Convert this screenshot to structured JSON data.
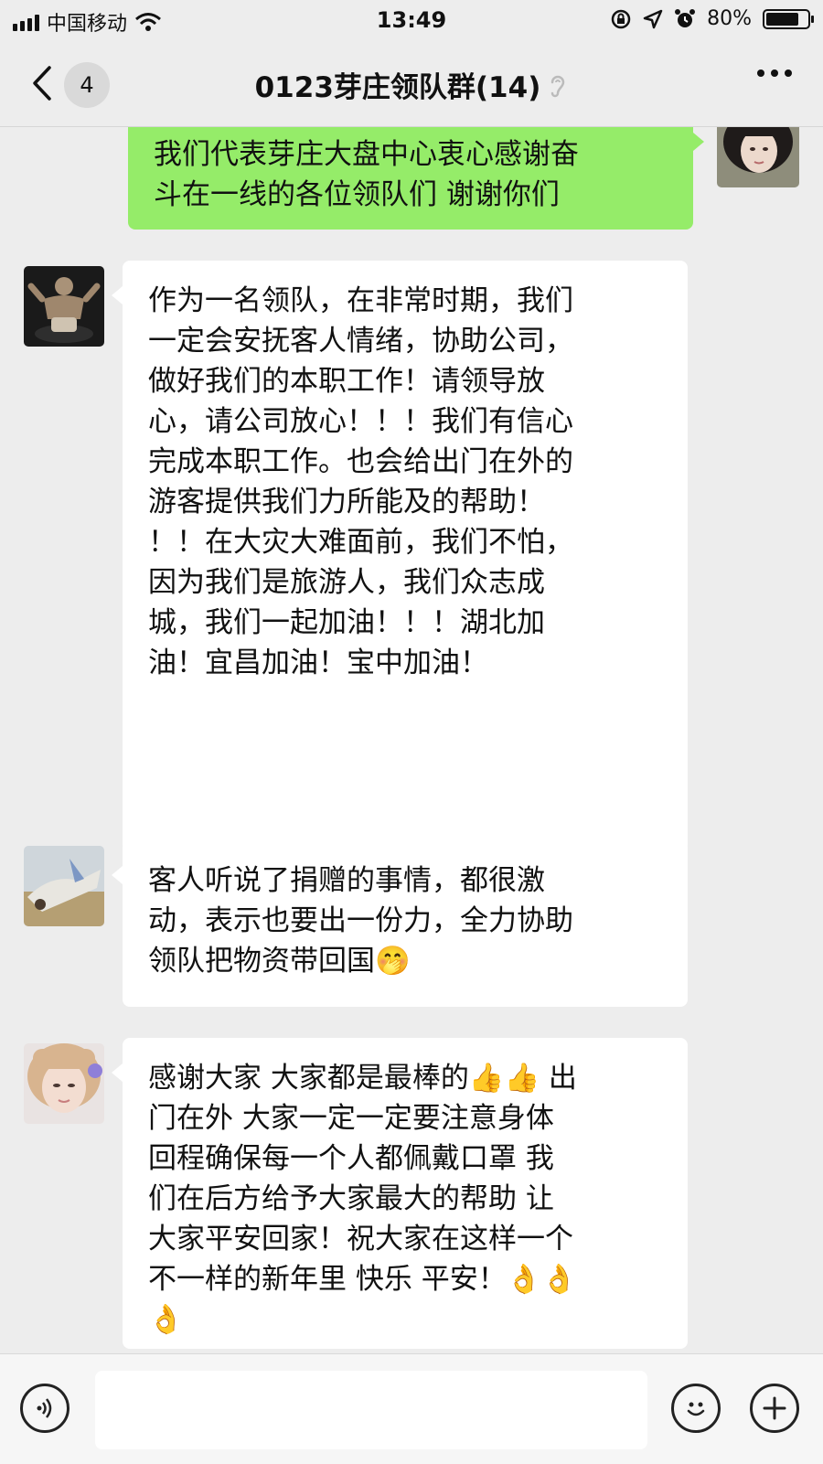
{
  "status_bar": {
    "carrier": "中国移动",
    "time": "13:49",
    "battery": "80%",
    "battery_level": 0.8
  },
  "header": {
    "back_count": "4",
    "title": "0123芽庄领队群(14)",
    "icons": [
      "back-chevron-icon",
      "earpiece-icon",
      "more-icon"
    ]
  },
  "messages": [
    {
      "side": "out",
      "avatar": "avatar-woman-dark-hair",
      "text": "我们代表芽庄大盘中心衷心感谢奋\n斗在一线的各位领队们 谢谢你们"
    },
    {
      "side": "in",
      "avatar": "avatar-figure-dark",
      "text": "作为一名领队，在非常时期，我们\n一定会安抚客人情绪，协助公司，\n做好我们的本职工作！请领导放\n心，请公司放心！！！我们有信心\n完成本职工作。也会给出门在外的\n游客提供我们力所能及的帮助！\n！！在大灾大难面前，我们不怕，\n因为我们是旅游人，我们众志成\n城，我们一起加油！！！湖北加\n油！宜昌加油！宝中加油！"
    },
    {
      "side": "in",
      "avatar": "avatar-landscape",
      "text": "客人听说了捐赠的事情，都很激\n动，表示也要出一份力，全力协助\n领队把物资带回国🤭"
    },
    {
      "side": "in",
      "avatar": "avatar-girl-light-hair",
      "text": "感谢大家 大家都是最棒的👍👍 出\n门在外 大家一定一定要注意身体\n回程确保每一个人都佩戴口罩 我\n们在后方给予大家最大的帮助 让\n大家平安回家！祝大家在这样一个\n不一样的新年里 快乐 平安！👌👌\n👌"
    }
  ],
  "timestamp": "13:49",
  "input_bar": {
    "icons": [
      "voice-icon",
      "emoji-icon",
      "plus-icon"
    ]
  },
  "colors": {
    "background": "#ededed",
    "outgoing_bubble": "#95ec69",
    "incoming_bubble": "#ffffff"
  }
}
